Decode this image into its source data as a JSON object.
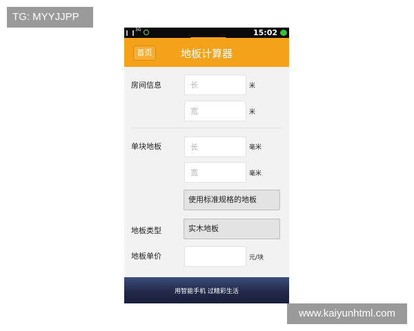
{
  "watermarks": {
    "top_left": "TG: MYYJJPP",
    "bottom_right": "www.kaiyunhtml.com"
  },
  "status_bar": {
    "network": "3G",
    "time": "15:02",
    "icons": [
      "signal-icon",
      "wifi-icon",
      "battery-icon"
    ]
  },
  "header": {
    "home_label": "首页",
    "title": "地板计算器",
    "color": "#f5a21b"
  },
  "room": {
    "label": "房间信息",
    "length_placeholder": "长",
    "width_placeholder": "宽",
    "unit": "米"
  },
  "plank": {
    "label": "单块地板",
    "length_placeholder": "长",
    "width_placeholder": "宽",
    "unit": "毫米",
    "standard_button": "使用标准规格的地板"
  },
  "type": {
    "label": "地板类型",
    "selected": "实木地板"
  },
  "price": {
    "label": "地板单价",
    "placeholder": "",
    "unit": "元/块"
  },
  "footer": {
    "slogan": "用智能手机 过精彩生活"
  }
}
